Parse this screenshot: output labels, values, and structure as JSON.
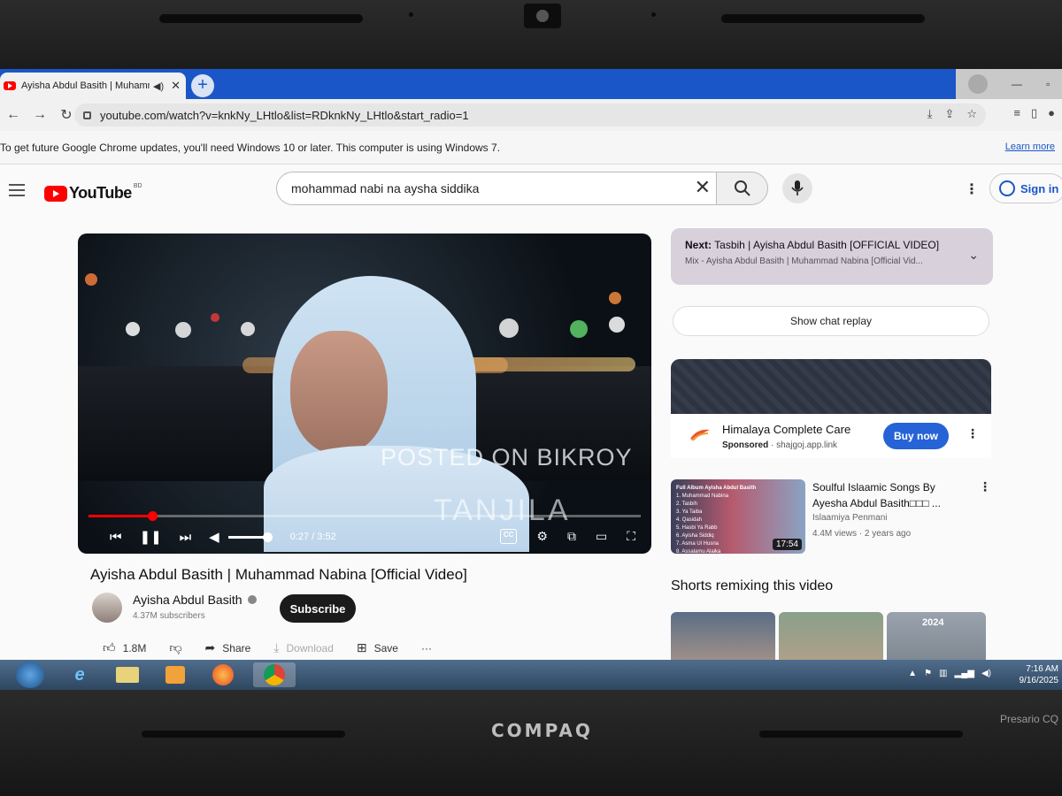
{
  "device": {
    "brand": "COMPAQ",
    "model": "Presario CQ"
  },
  "browser": {
    "tab": {
      "title": "Ayisha Abdul Basith | Muhammad Nabina [Official Video]",
      "audio_icon": "speaker-icon",
      "close": "✕"
    },
    "new_tab": "+",
    "url": "youtube.com/watch?v=knkNy_LHtlo&list=RDknkNy_LHtlo&start_radio=1",
    "infobar": {
      "message": "To get future Google Chrome updates, you'll need Windows 10 or later. This computer is using Windows 7.",
      "link": "Learn more"
    }
  },
  "youtube": {
    "logo_text": "YouTube",
    "country_code": "BD",
    "search": {
      "query": "mohammad nabi na aysha siddika"
    },
    "sign_in": "Sign in",
    "player": {
      "current_time": "0:27",
      "duration": "3:52",
      "time_display": "0:27 / 3:52",
      "progress_fraction": 0.116,
      "volume_fraction": 1.0,
      "cc_label": "CC"
    },
    "video": {
      "title": "Ayisha Abdul Basith | Muhammad Nabina [Official Video]",
      "channel": "Ayisha Abdul Basith",
      "subscribers": "4.37M subscribers",
      "subscribe": "Subscribe",
      "likes": "1.8M",
      "share": "Share",
      "download": "Download",
      "save": "Save",
      "more": "···"
    },
    "sidebar": {
      "next_label": "Next:",
      "next_title": "Tasbih | Ayisha Abdul Basith [OFFICIAL VIDEO]",
      "next_sub": "Mix - Ayisha Abdul Basith | Muhammad Nabina [Official Vid...",
      "chat_replay": "Show chat replay",
      "ad": {
        "title": "Himalaya Complete Care",
        "sponsored": "Sponsored",
        "domain": "shajgoj.app.link",
        "cta": "Buy now"
      },
      "recommended": {
        "title": "Soulful Islaamic Songs By Ayesha Abdul Basith□□□ ...",
        "channel": "Islaamiya Penmani",
        "meta": "4.4M views · 2 years ago",
        "duration": "17:54",
        "thumb_text": [
          "Full Album Ayisha Abdul Basith",
          "1. Muhammad Nabina",
          "2. Tasbih",
          "3. Ya Taiba",
          "4. Qasidah",
          "5. Hasbi Ya Rabb",
          "6. Ayisha Siddiq",
          "7. Asma Ul Husna",
          "8. Assalamu Alaika"
        ]
      },
      "shorts_heading": "Shorts remixing this video",
      "short_label": "2024"
    }
  },
  "watermark": {
    "line1": "POSTED ON BIKROY",
    "line2": "TANJILA"
  },
  "taskbar": {
    "time": "7:16 AM",
    "date": "9/16/2025"
  },
  "colors": {
    "chrome_blue": "#1a56c8",
    "yt_red": "#ff0000",
    "cta_blue": "#2563d6",
    "next_card": "#d8d0db"
  }
}
